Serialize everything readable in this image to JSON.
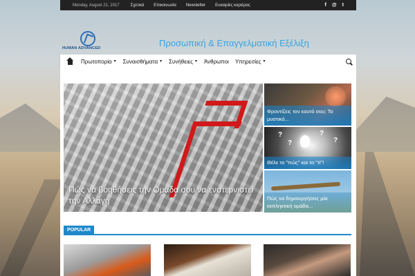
{
  "topbar": {
    "date": "Monday, August 21, 2017",
    "links": [
      "Σχετικά",
      "Επικοινωνία",
      "Newsletter",
      "Ευκαιρίες καριέρας"
    ],
    "social": [
      "f",
      "@",
      "t"
    ]
  },
  "header": {
    "logo_text": "HUMAN ADVANCED",
    "tagline": "Προσωπική & Επαγγελματική Εξέλιξη"
  },
  "nav": {
    "items": [
      "Πρωτοπορία",
      "Συναισθήματα",
      "Συνήθειες",
      "Άνθρωποι",
      "Υπηρεσίες"
    ],
    "dropdown": [
      true,
      true,
      true,
      false,
      true
    ]
  },
  "featured": {
    "main_title": "Πώς να βοηθήσεις την Ομάδα σου να ενστερνιστεί την Αλλαγή",
    "side": [
      "Φροντίζεις τον εαυτό σου; Το μυστικό...",
      "Θέλε το \"πώς\" και το \"τί\"!",
      "Πώς να δημιουργήσεις μία εκπληκτική ομάδα..."
    ]
  },
  "popular": {
    "label": "POPULAR"
  },
  "colors": {
    "accent": "#1e88c9",
    "tagline": "#36a3e0",
    "topbar": "#222222",
    "maze_red": "#d1191b"
  }
}
